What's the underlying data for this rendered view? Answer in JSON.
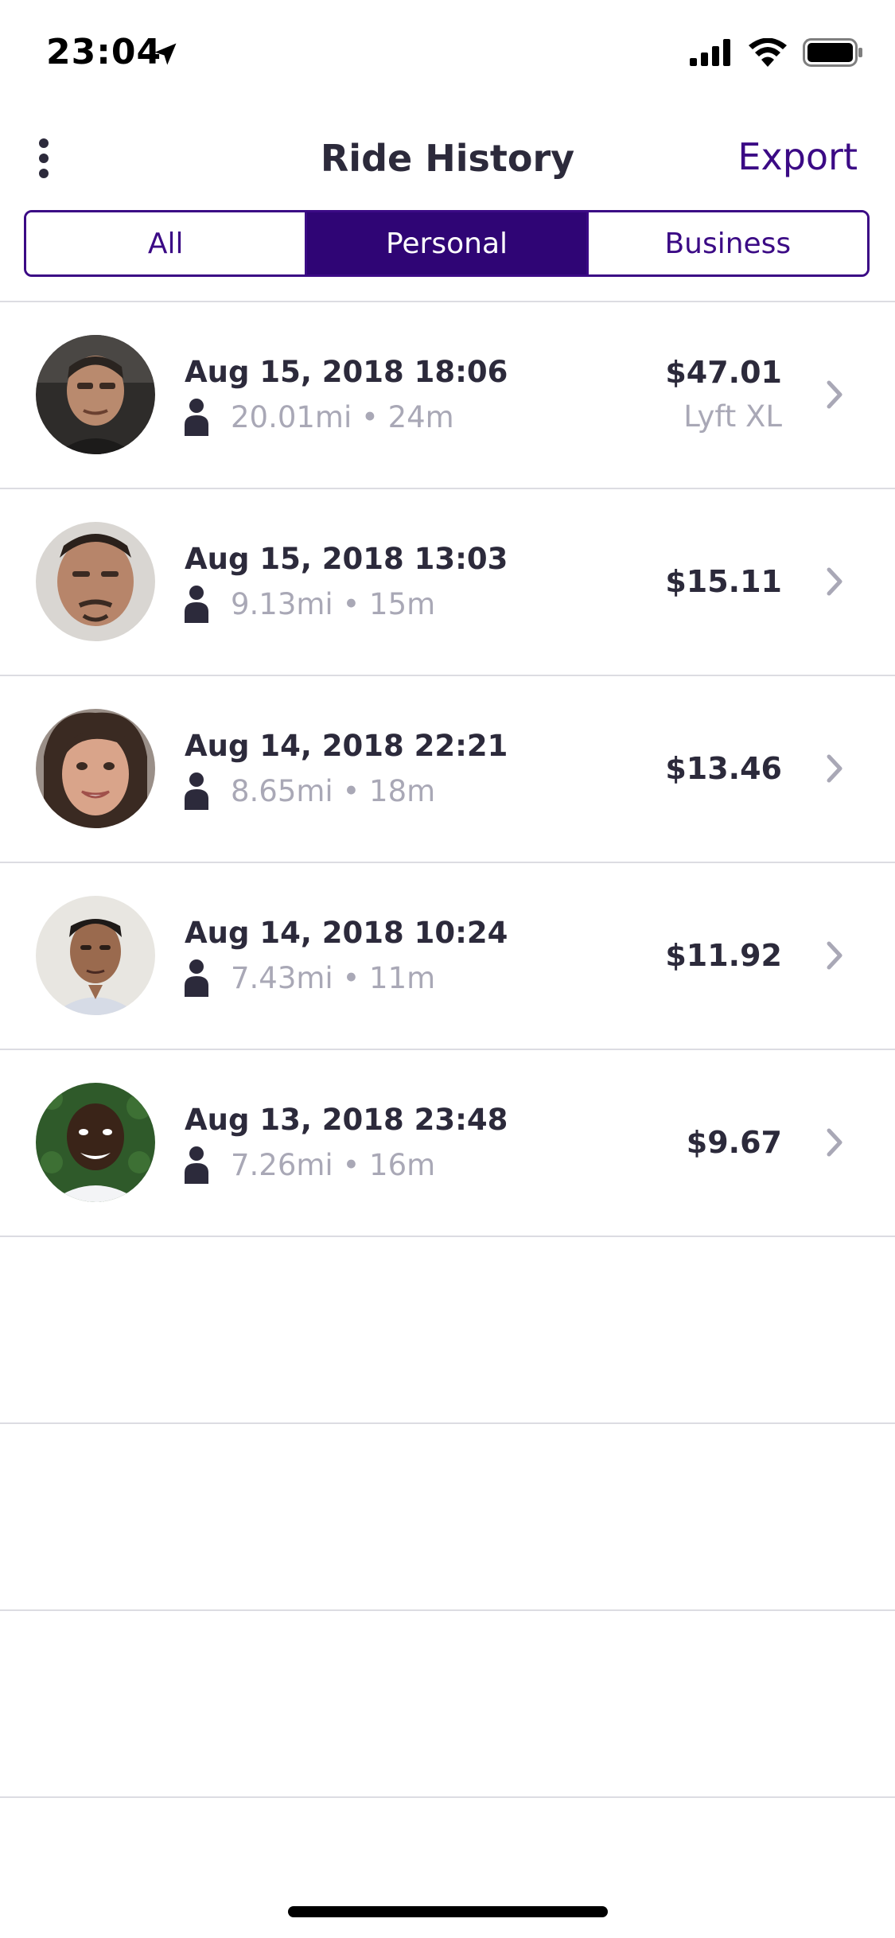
{
  "status_bar": {
    "time": "23:04"
  },
  "nav": {
    "title": "Ride History",
    "export_label": "Export"
  },
  "tabs": [
    {
      "label": "All",
      "selected": false
    },
    {
      "label": "Personal",
      "selected": true
    },
    {
      "label": "Business",
      "selected": false
    }
  ],
  "rides": [
    {
      "date": "Aug 15, 2018 18:06",
      "details": "20.01mi • 24m",
      "price": "$47.01",
      "ride_type": "Lyft XL"
    },
    {
      "date": "Aug 15, 2018 13:03",
      "details": "9.13mi • 15m",
      "price": "$15.11"
    },
    {
      "date": "Aug 14, 2018 22:21",
      "details": "8.65mi • 18m",
      "price": "$13.46"
    },
    {
      "date": "Aug 14, 2018 10:24",
      "details": "7.43mi • 11m",
      "price": "$11.92"
    },
    {
      "date": "Aug 13, 2018 23:48",
      "details": "7.26mi • 16m",
      "price": "$9.67"
    }
  ],
  "colors": {
    "accent": "#3b0a85",
    "selected_tab_bg": "#2f0575",
    "primary_text": "#2c2a3b",
    "secondary_text": "#a9a8b6",
    "separator": "#dcdce2"
  },
  "icons": {
    "menu": "more-vertical-icon",
    "location": "location-arrow-icon",
    "passenger": "person-icon",
    "chevron": "chevron-right-icon"
  }
}
